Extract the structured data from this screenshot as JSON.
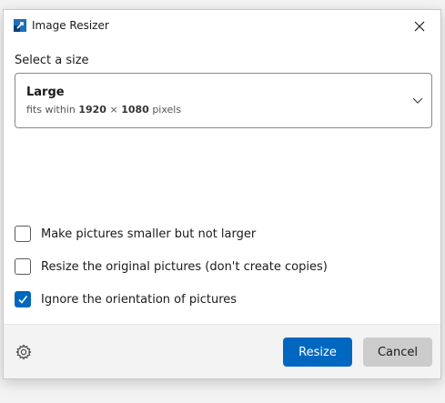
{
  "window": {
    "title": "Image Resizer",
    "app_icon": "image-resizer-icon",
    "close_icon": "close-icon"
  },
  "size_section": {
    "label": "Select a size",
    "selected": {
      "name": "Large",
      "desc_prefix": "fits within",
      "width": "1920",
      "times": "×",
      "height": "1080",
      "unit": "pixels"
    },
    "dropdown_icon": "chevron-down-icon"
  },
  "options": [
    {
      "label": "Make pictures smaller but not larger",
      "checked": false
    },
    {
      "label": "Resize the original pictures (don't create copies)",
      "checked": false
    },
    {
      "label": "Ignore the orientation of pictures",
      "checked": true
    }
  ],
  "footer": {
    "settings_icon": "gear-icon",
    "resize_label": "Resize",
    "cancel_label": "Cancel"
  },
  "colors": {
    "accent": "#0067c0",
    "secondary_button": "#cccccc",
    "footer_bg": "#f3f3f3"
  }
}
